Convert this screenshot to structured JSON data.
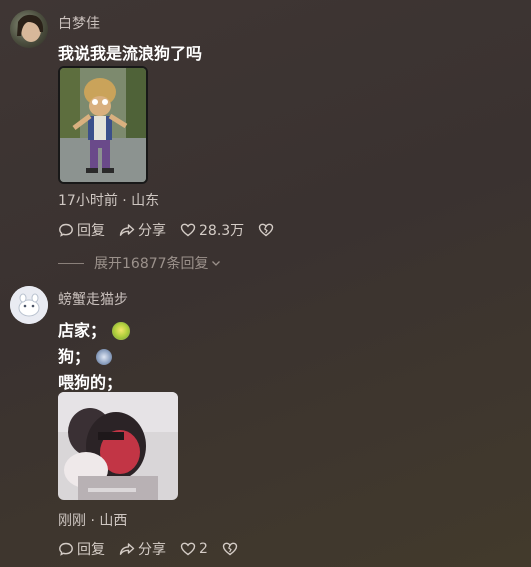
{
  "comments": [
    {
      "username": "白梦佳",
      "text": "我说我是流浪狗了吗",
      "meta": "17小时前 · 山东",
      "actions": {
        "reply": "回复",
        "share": "分享",
        "likes": "28.3万"
      },
      "expand": "展开16877条回复"
    },
    {
      "username": "螃蟹走猫步",
      "lines": [
        "店家；",
        "狗；",
        "喂狗的；"
      ],
      "meta": "刚刚 · 山西",
      "actions": {
        "reply": "回复",
        "share": "分享",
        "likes": "2"
      }
    }
  ],
  "icons": {
    "reply": "comment-bubble-icon",
    "share": "share-arrow-icon",
    "like": "heart-icon",
    "dislike": "broken-heart-icon",
    "expand": "chevron-down-icon"
  }
}
